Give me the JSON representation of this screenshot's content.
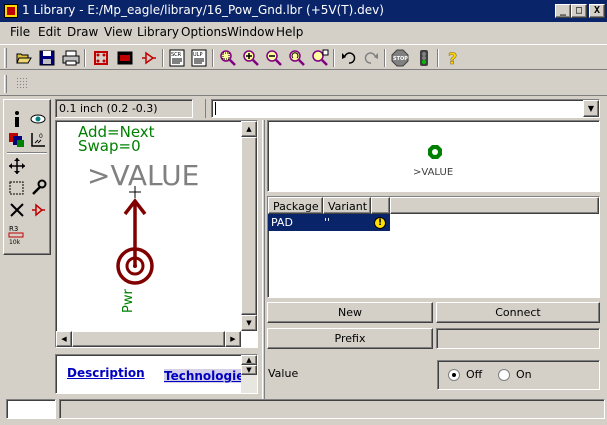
{
  "window": {
    "title": "1 Library - E:/Mp_eagle/library/16_Pow_Gnd.lbr (+5V(T).dev)",
    "caption_buttons": {
      "minimize": "_",
      "maximize": "□",
      "close": "X"
    }
  },
  "menu": {
    "items": [
      "File",
      "Edit",
      "Draw",
      "View",
      "Library",
      "Options",
      "Window",
      "Help"
    ]
  },
  "toolbar": {
    "icons": [
      "open-icon",
      "save-icon",
      "print-icon",
      "cam-icon",
      "board-icon",
      "schematic-icon",
      "script-icon",
      "ulp-icon",
      "zoom-fit-icon",
      "zoom-in-icon",
      "zoom-out-icon",
      "zoom-redraw-icon",
      "zoom-select-icon",
      "undo-icon",
      "redo-icon",
      "stop-icon",
      "go-icon",
      "help-icon"
    ],
    "script_label": "SCR",
    "ulp_label": "ULP",
    "stop_label": "STOP",
    "help_label": "?"
  },
  "coord": {
    "text": "0.1 inch (0.2 -0.3)"
  },
  "command": {
    "value": ""
  },
  "palette": {
    "resistor_label": "R3",
    "resistor_value": "10k"
  },
  "canvas": {
    "addlevel": "Add=Next",
    "swaplevel": "Swap=0",
    "value_text": ">VALUE",
    "pin_name": "Pwr"
  },
  "description": {
    "link1": "Description",
    "link2": "Technologies"
  },
  "preview": {
    "value_text": ">VALUE"
  },
  "package_table": {
    "headers": [
      "Package",
      "Variant"
    ],
    "rows": [
      {
        "package": "PAD",
        "variant": "''",
        "status": "!"
      }
    ]
  },
  "buttons": {
    "new": "New",
    "connect": "Connect",
    "prefix": "Prefix"
  },
  "value_option": {
    "label": "Value",
    "off": "Off",
    "on": "On",
    "selected": "Off"
  },
  "colors": {
    "title_bar": "#0a246a",
    "window": "#d4d0c8",
    "symbol_text": "#808080",
    "symbol_pin": "#800000",
    "symbol_label": "#008000",
    "selection": "#0a246a"
  }
}
